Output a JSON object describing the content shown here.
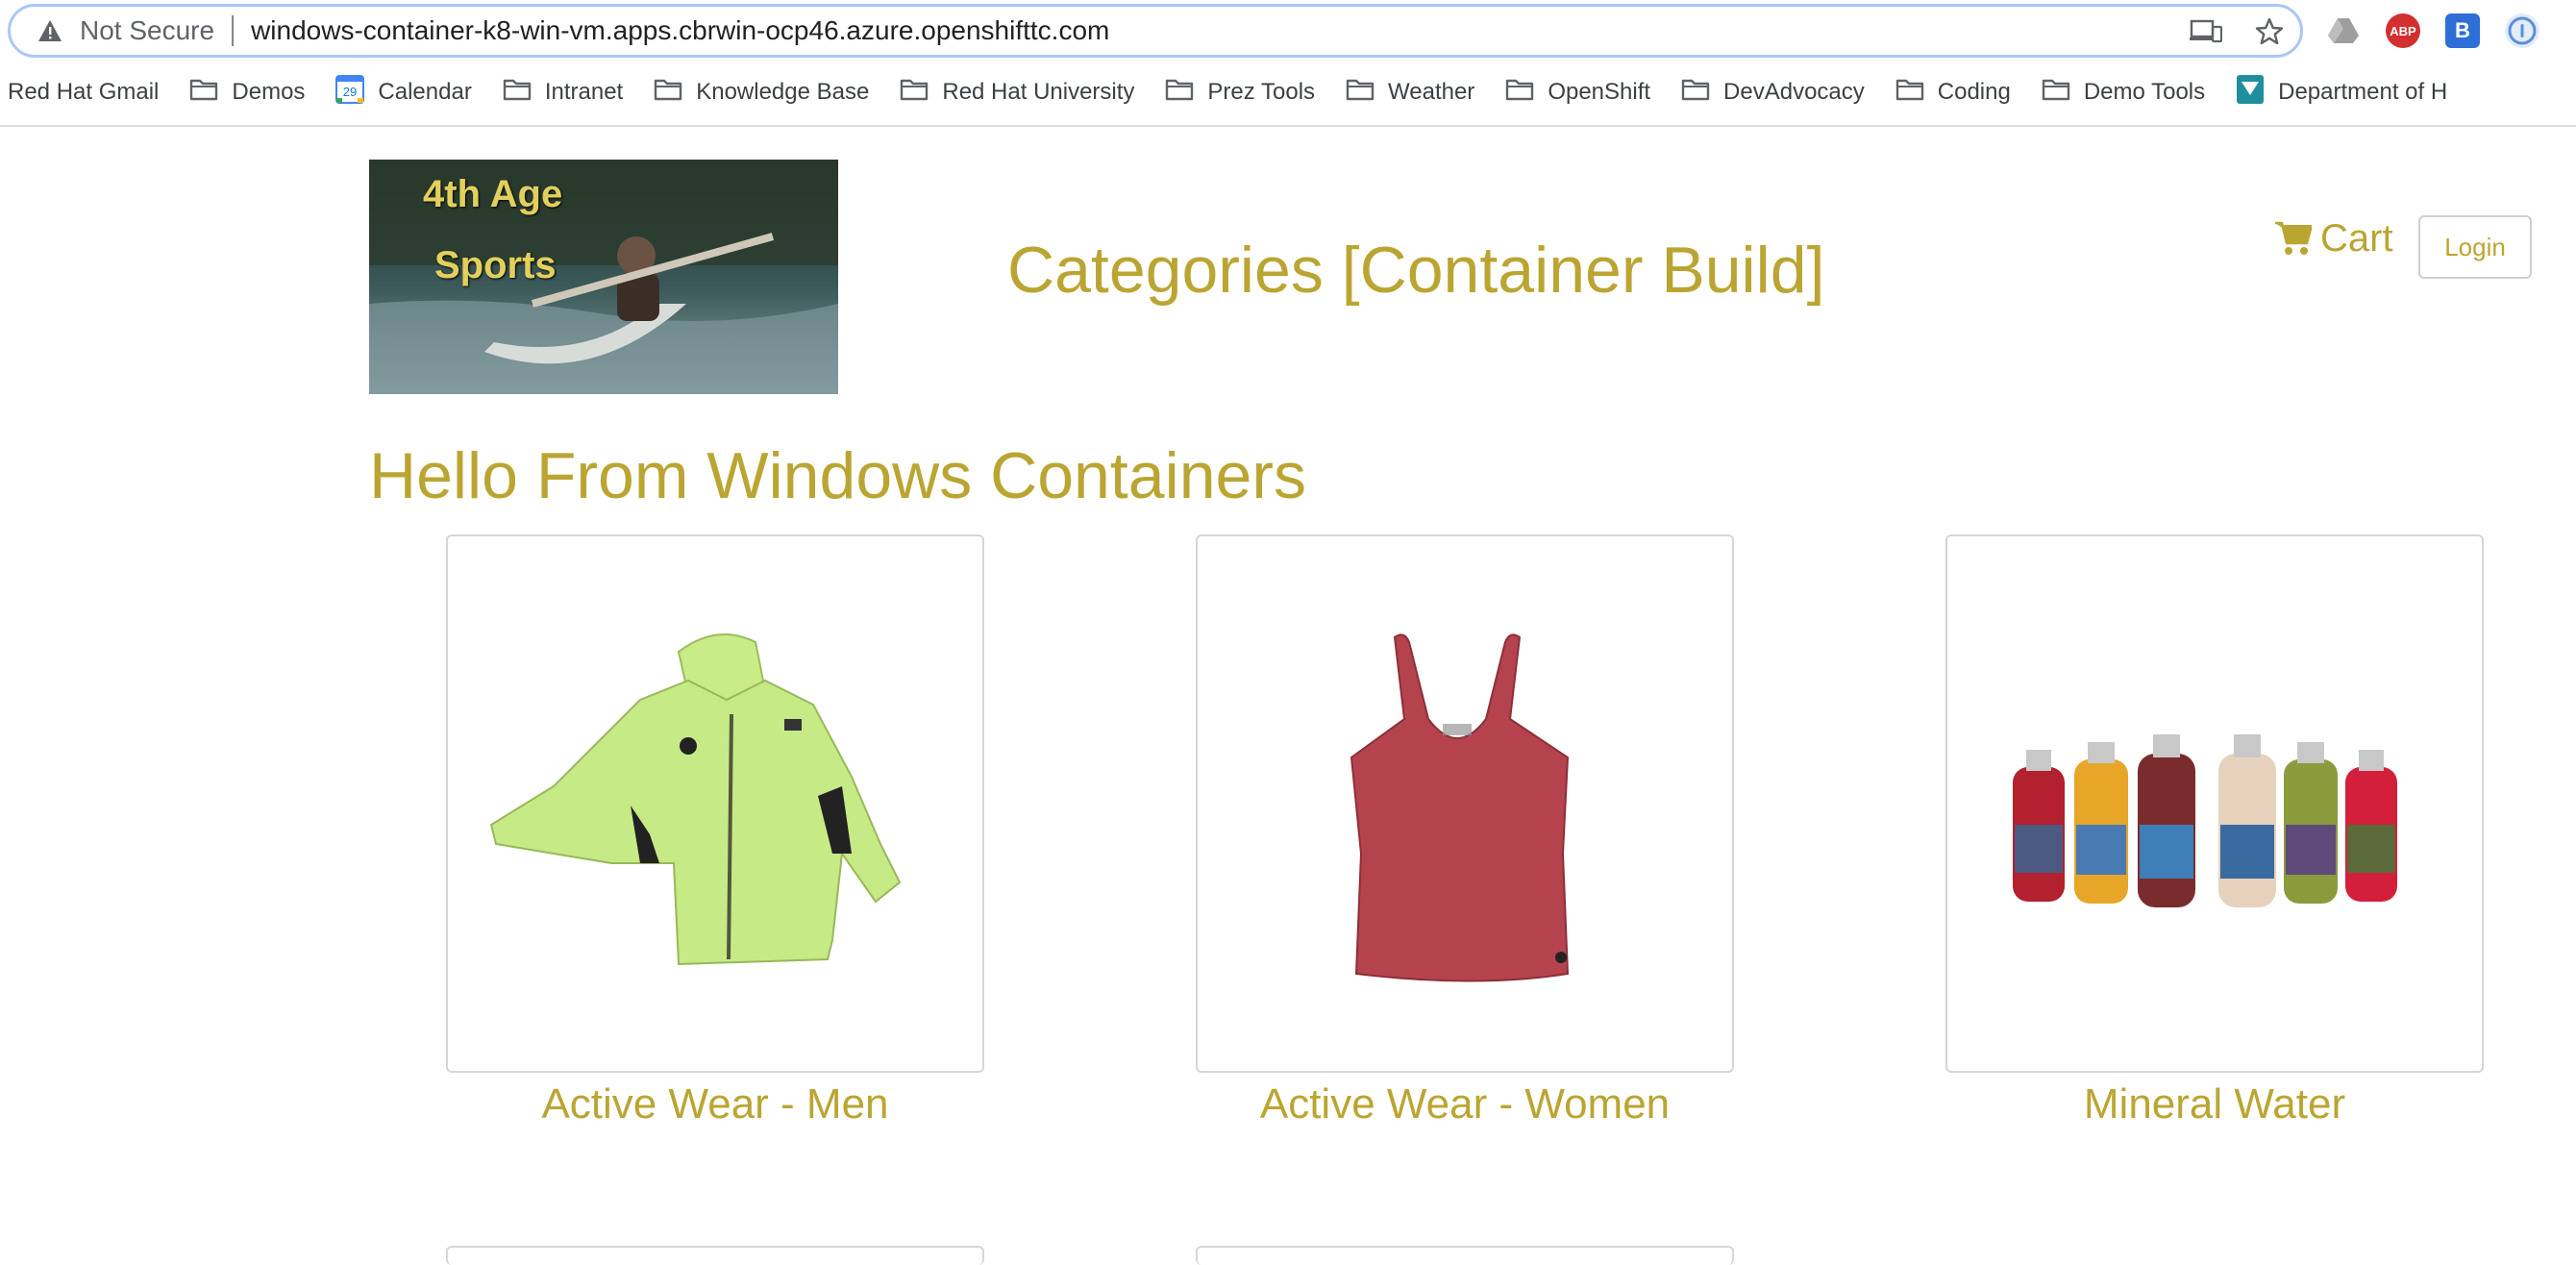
{
  "browser": {
    "security_label": "Not Secure",
    "url": "windows-container-k8-win-vm.apps.cbrwin-ocp46.azure.openshifttc.com",
    "bookmarks": [
      {
        "label": "Red Hat Gmail",
        "icon": "none"
      },
      {
        "label": "Demos",
        "icon": "folder-icon"
      },
      {
        "label": "Calendar",
        "icon": "calendar-icon"
      },
      {
        "label": "Intranet",
        "icon": "folder-icon"
      },
      {
        "label": "Knowledge Base",
        "icon": "folder-icon"
      },
      {
        "label": "Red Hat University",
        "icon": "folder-icon"
      },
      {
        "label": "Prez Tools",
        "icon": "folder-icon"
      },
      {
        "label": "Weather",
        "icon": "folder-icon"
      },
      {
        "label": "OpenShift",
        "icon": "folder-icon"
      },
      {
        "label": "DevAdvocacy",
        "icon": "folder-icon"
      },
      {
        "label": "Coding",
        "icon": "folder-icon"
      },
      {
        "label": "Demo Tools",
        "icon": "folder-icon"
      },
      {
        "label": "Department of H",
        "icon": "dept-icon"
      }
    ],
    "calendar_day": "29",
    "extensions": [
      {
        "name": "drive-icon"
      },
      {
        "name": "adblock-icon",
        "text": "ABP",
        "color": "#d32f2f"
      },
      {
        "name": "bluejeans-icon",
        "text": "B",
        "color": "#2d6fd6"
      },
      {
        "name": "info-circle-icon",
        "color": "#5b8fd9"
      }
    ]
  },
  "header": {
    "logo_line1": "4th Age",
    "logo_line2": "Sports",
    "title": "Categories [Container Build]",
    "cart_label": "Cart",
    "login_label": "Login"
  },
  "main": {
    "heading": "Hello From Windows Containers",
    "categories": [
      {
        "label": "Active Wear - Men",
        "image": "green-jacket"
      },
      {
        "label": "Active Wear - Women",
        "image": "red-tank-top"
      },
      {
        "label": "Mineral Water",
        "image": "water-bottles"
      }
    ]
  },
  "theme": {
    "accent": "#bba532",
    "omnibox_border": "#a8c7fa"
  }
}
